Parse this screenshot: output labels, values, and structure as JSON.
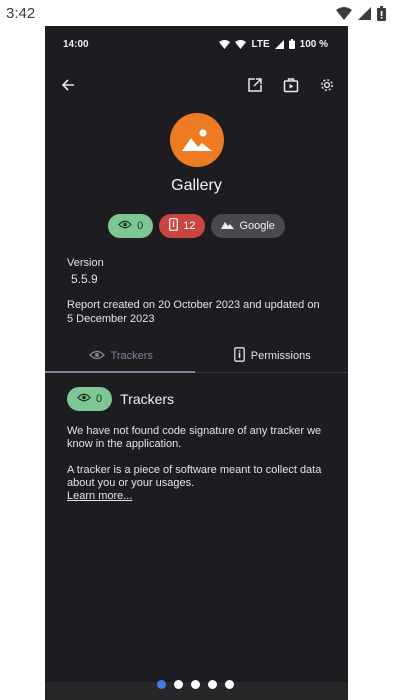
{
  "device_status": {
    "time": "3:42"
  },
  "status_bar": {
    "time": "14:00",
    "network": "LTE",
    "battery": "100 %"
  },
  "app": {
    "name": "Gallery",
    "icon_color": "#ee7b22",
    "badges": {
      "trackers": "0",
      "permissions": "12",
      "source": "Google"
    },
    "version_label": "Version",
    "version": "5.5.9",
    "report_text": "Report created on 20 October 2023 and updated on 5 December 2023"
  },
  "tabs": [
    {
      "label": "Trackers",
      "icon": "eye-icon",
      "active": true
    },
    {
      "label": "Permissions",
      "icon": "phone-info-icon",
      "active": false
    }
  ],
  "trackers_section": {
    "count": "0",
    "title": "Trackers",
    "paragraph1": "We have not found code signature of any tracker we know in the application.",
    "paragraph2": "A tracker is a piece of software meant to collect data about you or your usages.",
    "learn_more": "Learn more..."
  },
  "pager": {
    "count": 5,
    "active_index": 0
  }
}
